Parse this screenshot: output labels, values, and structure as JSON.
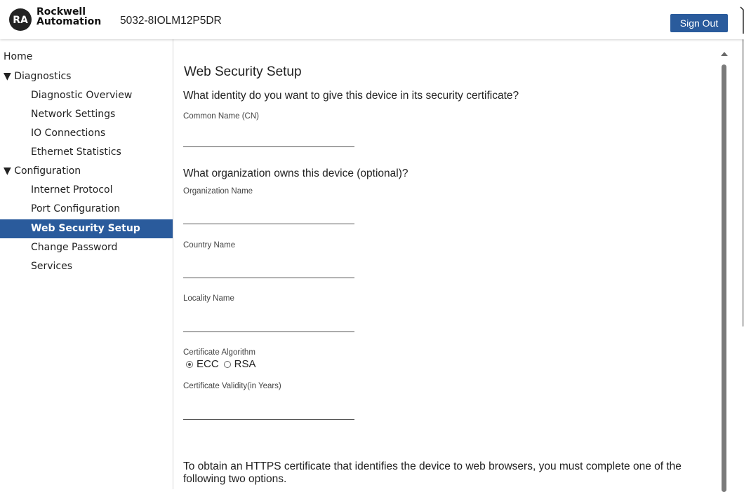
{
  "header": {
    "logo": {
      "badge": "RA",
      "line1": "Rockwell",
      "line2": "Automation"
    },
    "device_name": "5032-8IOLM12P5DR",
    "sign_out_label": "Sign Out",
    "accent_color": "#2a5b9c"
  },
  "sidebar": {
    "items": [
      {
        "label": "Home",
        "level": 0
      },
      {
        "label": "▼ Diagnostics",
        "level": 0
      },
      {
        "label": "Diagnostic Overview",
        "level": 1
      },
      {
        "label": "Network Settings",
        "level": 1
      },
      {
        "label": "IO Connections",
        "level": 1
      },
      {
        "label": "Ethernet Statistics",
        "level": 1
      },
      {
        "label": "▼ Configuration",
        "level": 0
      },
      {
        "label": "Internet Protocol",
        "level": 1
      },
      {
        "label": "Port Configuration",
        "level": 1
      },
      {
        "label": "Web Security Setup",
        "level": 1,
        "active": true
      },
      {
        "label": "Change Password",
        "level": 1
      },
      {
        "label": "Services",
        "level": 1
      }
    ]
  },
  "main": {
    "title": "Web Security Setup",
    "identity_question": "What identity do you want to give this device in its security certificate?",
    "common_name_label": "Common Name (CN)",
    "organization_question": "What organization owns this device (optional)?",
    "organization_name_label": "Organization Name",
    "country_name_label": "Country Name",
    "locality_name_label": "Locality Name",
    "algorithm_label": "Certificate Algorithm",
    "algorithm_options": [
      {
        "label": "ECC",
        "selected": true
      },
      {
        "label": "RSA",
        "selected": false
      }
    ],
    "validity_label": "Certificate Validity(in Years)",
    "https_note": "To obtain an HTTPS certificate that identifies the device to web browsers, you must complete one of the following two options."
  }
}
